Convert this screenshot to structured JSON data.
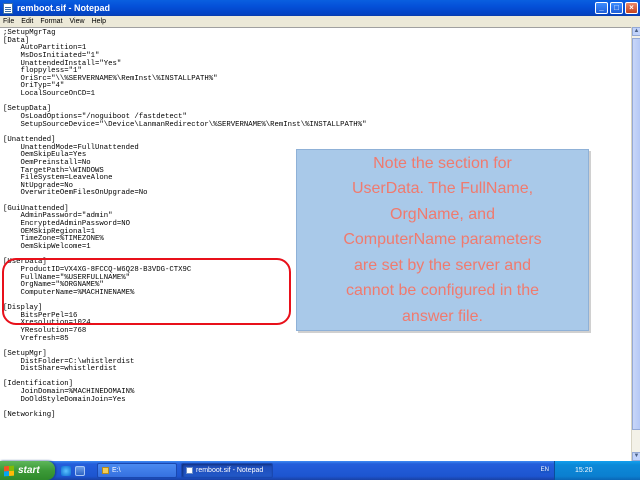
{
  "window": {
    "title": "remboot.sif - Notepad",
    "controls": {
      "minimize": "_",
      "maximize": "□",
      "close": "×"
    }
  },
  "menu": [
    "File",
    "Edit",
    "Format",
    "View",
    "Help"
  ],
  "document": {
    "lines": [
      ";SetupMgrTag",
      "[Data]",
      "    AutoPartition=1",
      "    MsDosInitiated=\"1\"",
      "    UnattendedInstall=\"Yes\"",
      "    floppyless=\"1\"",
      "    OriSrc=\"\\\\%SERVERNAME%\\RemInst\\%INSTALLPATH%\"",
      "    OriTyp=\"4\"",
      "    LocalSourceOnCD=1",
      "",
      "[SetupData]",
      "    OsLoadOptions=\"/noguiboot /fastdetect\"",
      "    SetupSourceDevice=\"\\Device\\LanmanRedirector\\%SERVERNAME%\\RemInst\\%INSTALLPATH%\"",
      "",
      "[Unattended]",
      "    UnattendMode=FullUnattended",
      "    OemSkipEula=Yes",
      "    OemPreinstall=No",
      "    TargetPath=\\WINDOWS",
      "    FileSystem=LeaveAlone",
      "    NtUpgrade=No",
      "    OverwriteOemFilesOnUpgrade=No",
      "",
      "[GuiUnattended]",
      "    AdminPassword=\"admin\"",
      "    EncryptedAdminPassword=NO",
      "    OEMSkipRegional=1",
      "    TimeZone=%TIMEZONE%",
      "    OemSkipWelcome=1",
      "",
      "[UserData]",
      "    ProductID=VX4XG-8FCCQ-W6Q28-B3VDG-CTX9C",
      "    FullName=\"%USERFULLNAME%\"",
      "    OrgName=\"%ORGNAME%\"",
      "    ComputerName=%MACHINENAME%",
      "",
      "[Display]",
      "    BitsPerPel=16",
      "    Xresolution=1024",
      "    YResolution=768",
      "    Vrefresh=85",
      "",
      "[SetupMgr]",
      "    DistFolder=C:\\whistlerdist",
      "    DistShare=whistlerdist",
      "",
      "[Identification]",
      "    JoinDomain=%MACHINEDOMAIN%",
      "    DoOldStyleDomainJoin=Yes",
      "",
      "[Networking]"
    ]
  },
  "callout": {
    "lines": [
      "Note the section for",
      "UserData. The FullName,",
      "OrgName, and",
      "ComputerName parameters",
      "are set by the server and",
      "cannot be configured in the",
      "answer file."
    ],
    "text_color": "#f07a6e",
    "background": "#a9c9e9",
    "highlight_color": "#e8101a"
  },
  "taskbar": {
    "start_label": "start",
    "buttons": [
      {
        "label": "E:\\"
      },
      {
        "label": "remboot.sif - Notepad"
      }
    ],
    "language": "EN",
    "clock": "15:20"
  }
}
